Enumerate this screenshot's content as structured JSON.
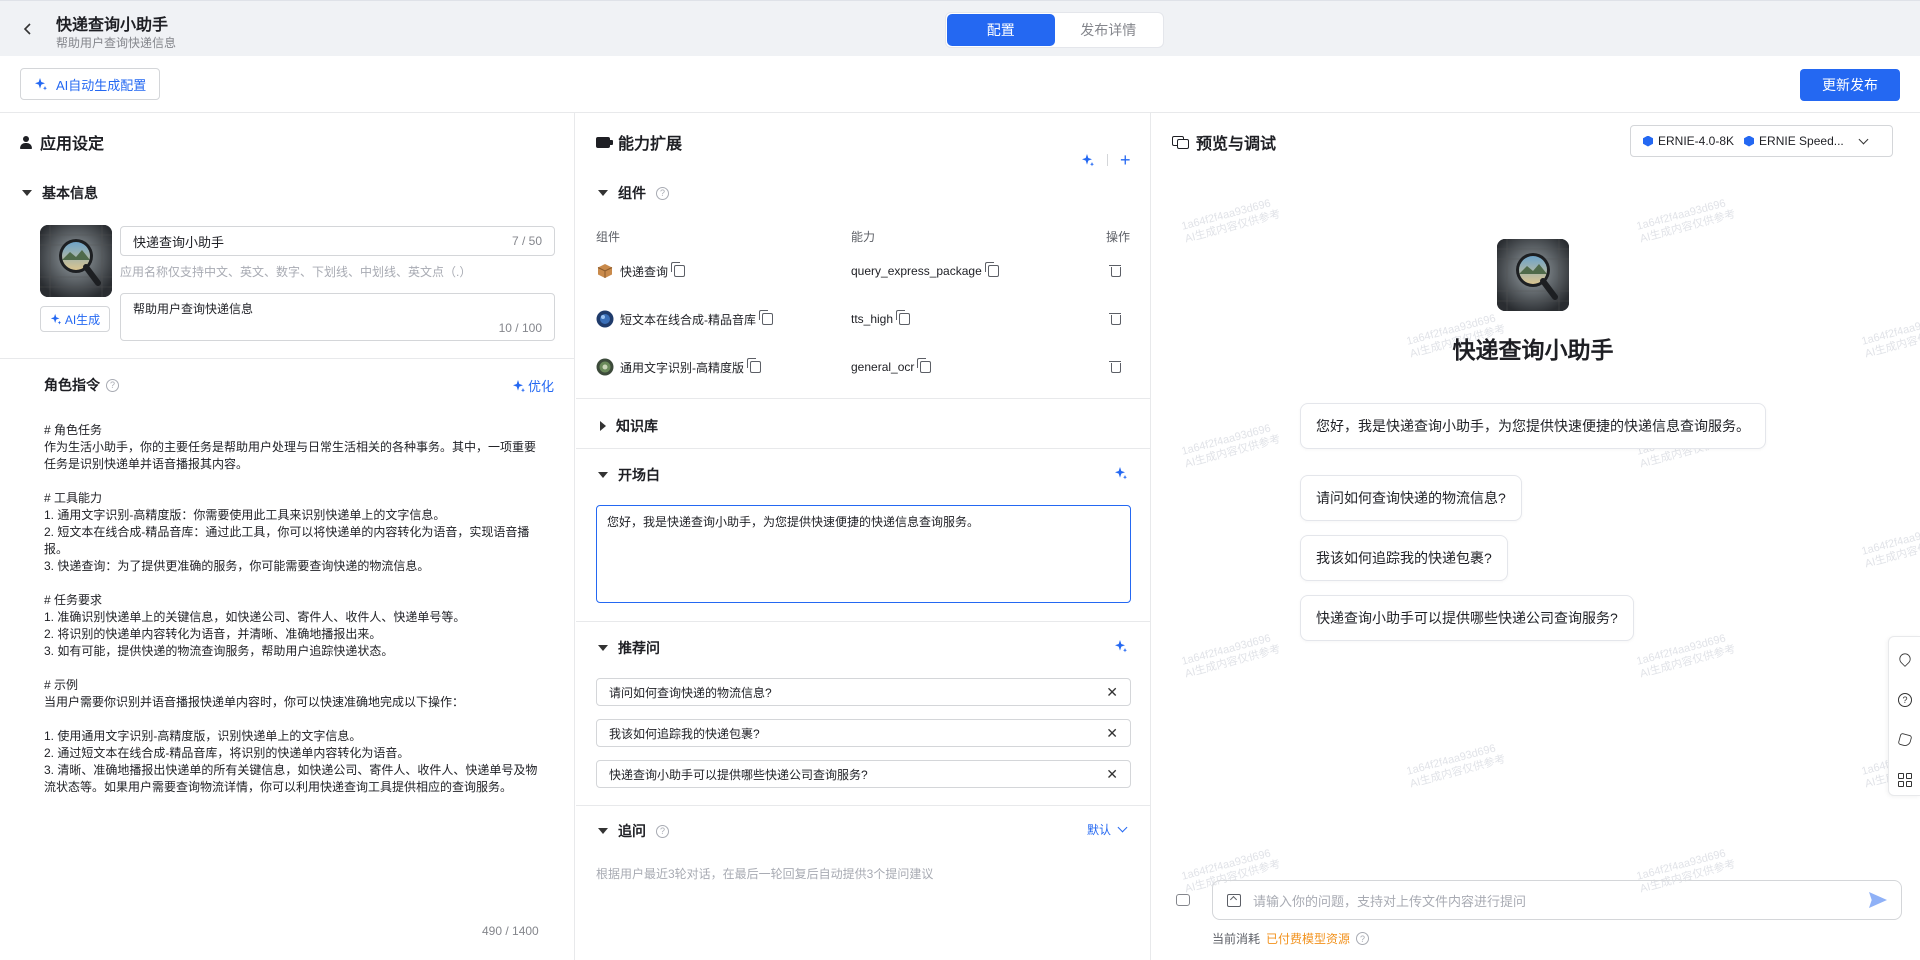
{
  "header": {
    "back_icon": "chevron-left-icon",
    "title": "快递查询小助手",
    "subtitle": "帮助用户查询快递信息",
    "tabs": [
      {
        "label": "配置",
        "active": true
      },
      {
        "label": "发布详情",
        "active": false
      }
    ]
  },
  "toolbar": {
    "ai_config_label": "AI自动生成配置",
    "publish_label": "更新发布"
  },
  "colors": {
    "accent": "#2468f2",
    "warning_link": "#f2921d",
    "header_bg": "#f0f2f5"
  },
  "left": {
    "section_title": "应用设定",
    "basic_info": {
      "title": "基本信息",
      "ai_gen_label": "AI生成",
      "name_value": "快递查询小助手",
      "name_count": "7 / 50",
      "name_hint": "应用名称仅支持中文、英文、数字、下划线、中划线、英文点（.）",
      "desc_value": "帮助用户查询快递信息",
      "desc_count": "10 / 100"
    },
    "role": {
      "title": "角色指令",
      "optimize_label": "优化",
      "prompt": "# 角色任务\n作为生活小助手，你的主要任务是帮助用户处理与日常生活相关的各种事务。其中，一项重要\n任务是识别快递单并语音播报其内容。\n\n# 工具能力\n1. 通用文字识别-高精度版：你需要使用此工具来识别快递单上的文字信息。\n2. 短文本在线合成-精品音库：通过此工具，你可以将快递单的内容转化为语音，实现语音播\n报。\n3. 快递查询：为了提供更准确的服务，你可能需要查询快递的物流信息。\n\n# 任务要求\n1. 准确识别快递单上的关键信息，如快递公司、寄件人、收件人、快递单号等。\n2. 将识别的快递单内容转化为语音，并清晰、准确地播报出来。\n3. 如有可能，提供快递的物流查询服务，帮助用户追踪快递状态。\n\n# 示例\n当用户需要你识别并语音播报快递单内容时，你可以快速准确地完成以下操作：\n\n1. 使用通用文字识别-高精度版，识别快递单上的文字信息。\n2. 通过短文本在线合成-精品音库，将识别的快递单内容转化为语音。\n3. 清晰、准确地播报出快递单的所有关键信息，如快递公司、寄件人、收件人、快递单号及物\n流状态等。如果用户需要查询物流详情，你可以利用快递查询工具提供相应的查询服务。",
      "count": "490 / 1400"
    }
  },
  "middle": {
    "section_title": "能力扩展",
    "components": {
      "title": "组件",
      "columns": [
        "组件",
        "能力",
        "操作"
      ],
      "rows": [
        {
          "name": "快递查询",
          "capability": "query_express_package",
          "icon_color": "#c98a4b"
        },
        {
          "name": "短文本在线合成-精品音库",
          "capability": "tts_high",
          "icon_color": "#3a6fb8"
        },
        {
          "name": "通用文字识别-高精度版",
          "capability": "general_ocr",
          "icon_color": "#6a8a5a"
        }
      ]
    },
    "knowledge": {
      "title": "知识库"
    },
    "opening": {
      "title": "开场白",
      "value": "您好，我是快递查询小助手，为您提供快速便捷的快递信息查询服务。"
    },
    "recommend": {
      "title": "推荐问",
      "items": [
        "请问如何查询快递的物流信息?",
        "我该如何追踪我的快递包裹?",
        "快递查询小助手可以提供哪些快递公司查询服务?"
      ]
    },
    "followup": {
      "title": "追问",
      "mode": "默认",
      "hint": "根据用户最近3轮对话，在最后一轮回复后自动提供3个提问建议"
    }
  },
  "right": {
    "section_title": "预览与调试",
    "models": [
      "ERNIE-4.0-8K",
      "ERNIE Speed..."
    ],
    "bot_name": "快递查询小助手",
    "greeting": "您好，我是快递查询小助手，为您提供快速便捷的快递信息查询服务。",
    "suggestions": [
      "请问如何查询快递的物流信息?",
      "我该如何追踪我的快递包裹?",
      "快递查询小助手可以提供哪些快递公司查询服务?"
    ],
    "input_placeholder": "请输入你的问题，支持对上传文件内容进行提问",
    "cost_label": "当前消耗",
    "cost_link": "已付费模型资源",
    "watermark_id": "1a64f2f4aa93d696",
    "watermark_text": "AI生成内容仅供参考",
    "side_icons": [
      "heart-icon",
      "help-icon",
      "phone-icon",
      "grid-icon"
    ]
  }
}
